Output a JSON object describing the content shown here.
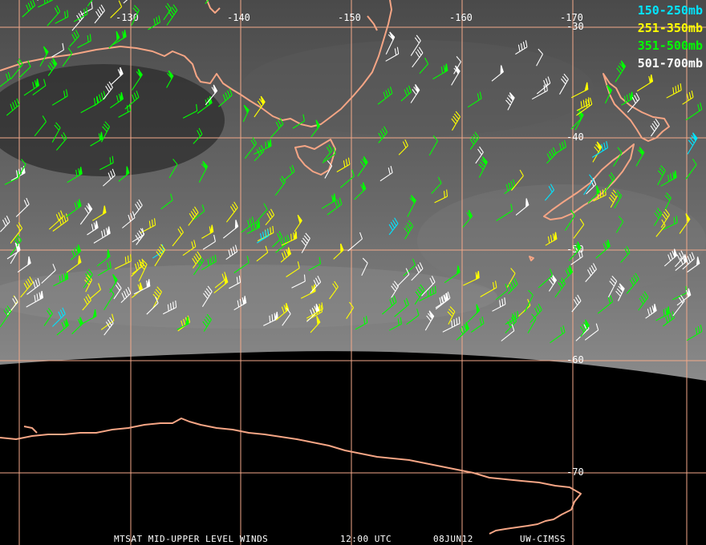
{
  "map": {
    "lon_labels": [
      "-130",
      "-140",
      "-150",
      "-160",
      "-170"
    ],
    "lat_labels": [
      "-30",
      "-40",
      "-50",
      "-60",
      "-70"
    ],
    "grid_color": "#f3a98a",
    "coast_color": "#f5a585"
  },
  "legend": {
    "items": [
      {
        "label": "150-250mb",
        "color": "#00e5ff"
      },
      {
        "label": "251-350mb",
        "color": "#ffff00"
      },
      {
        "label": "351-500mb",
        "color": "#00ff00"
      },
      {
        "label": "501-700mb",
        "color": "#ffffff"
      }
    ]
  },
  "footer": {
    "product": "MTSAT MID-UPPER LEVEL WINDS",
    "time": "12:00 UTC",
    "date": "08JUN12",
    "source": "UW-CIMSS"
  }
}
